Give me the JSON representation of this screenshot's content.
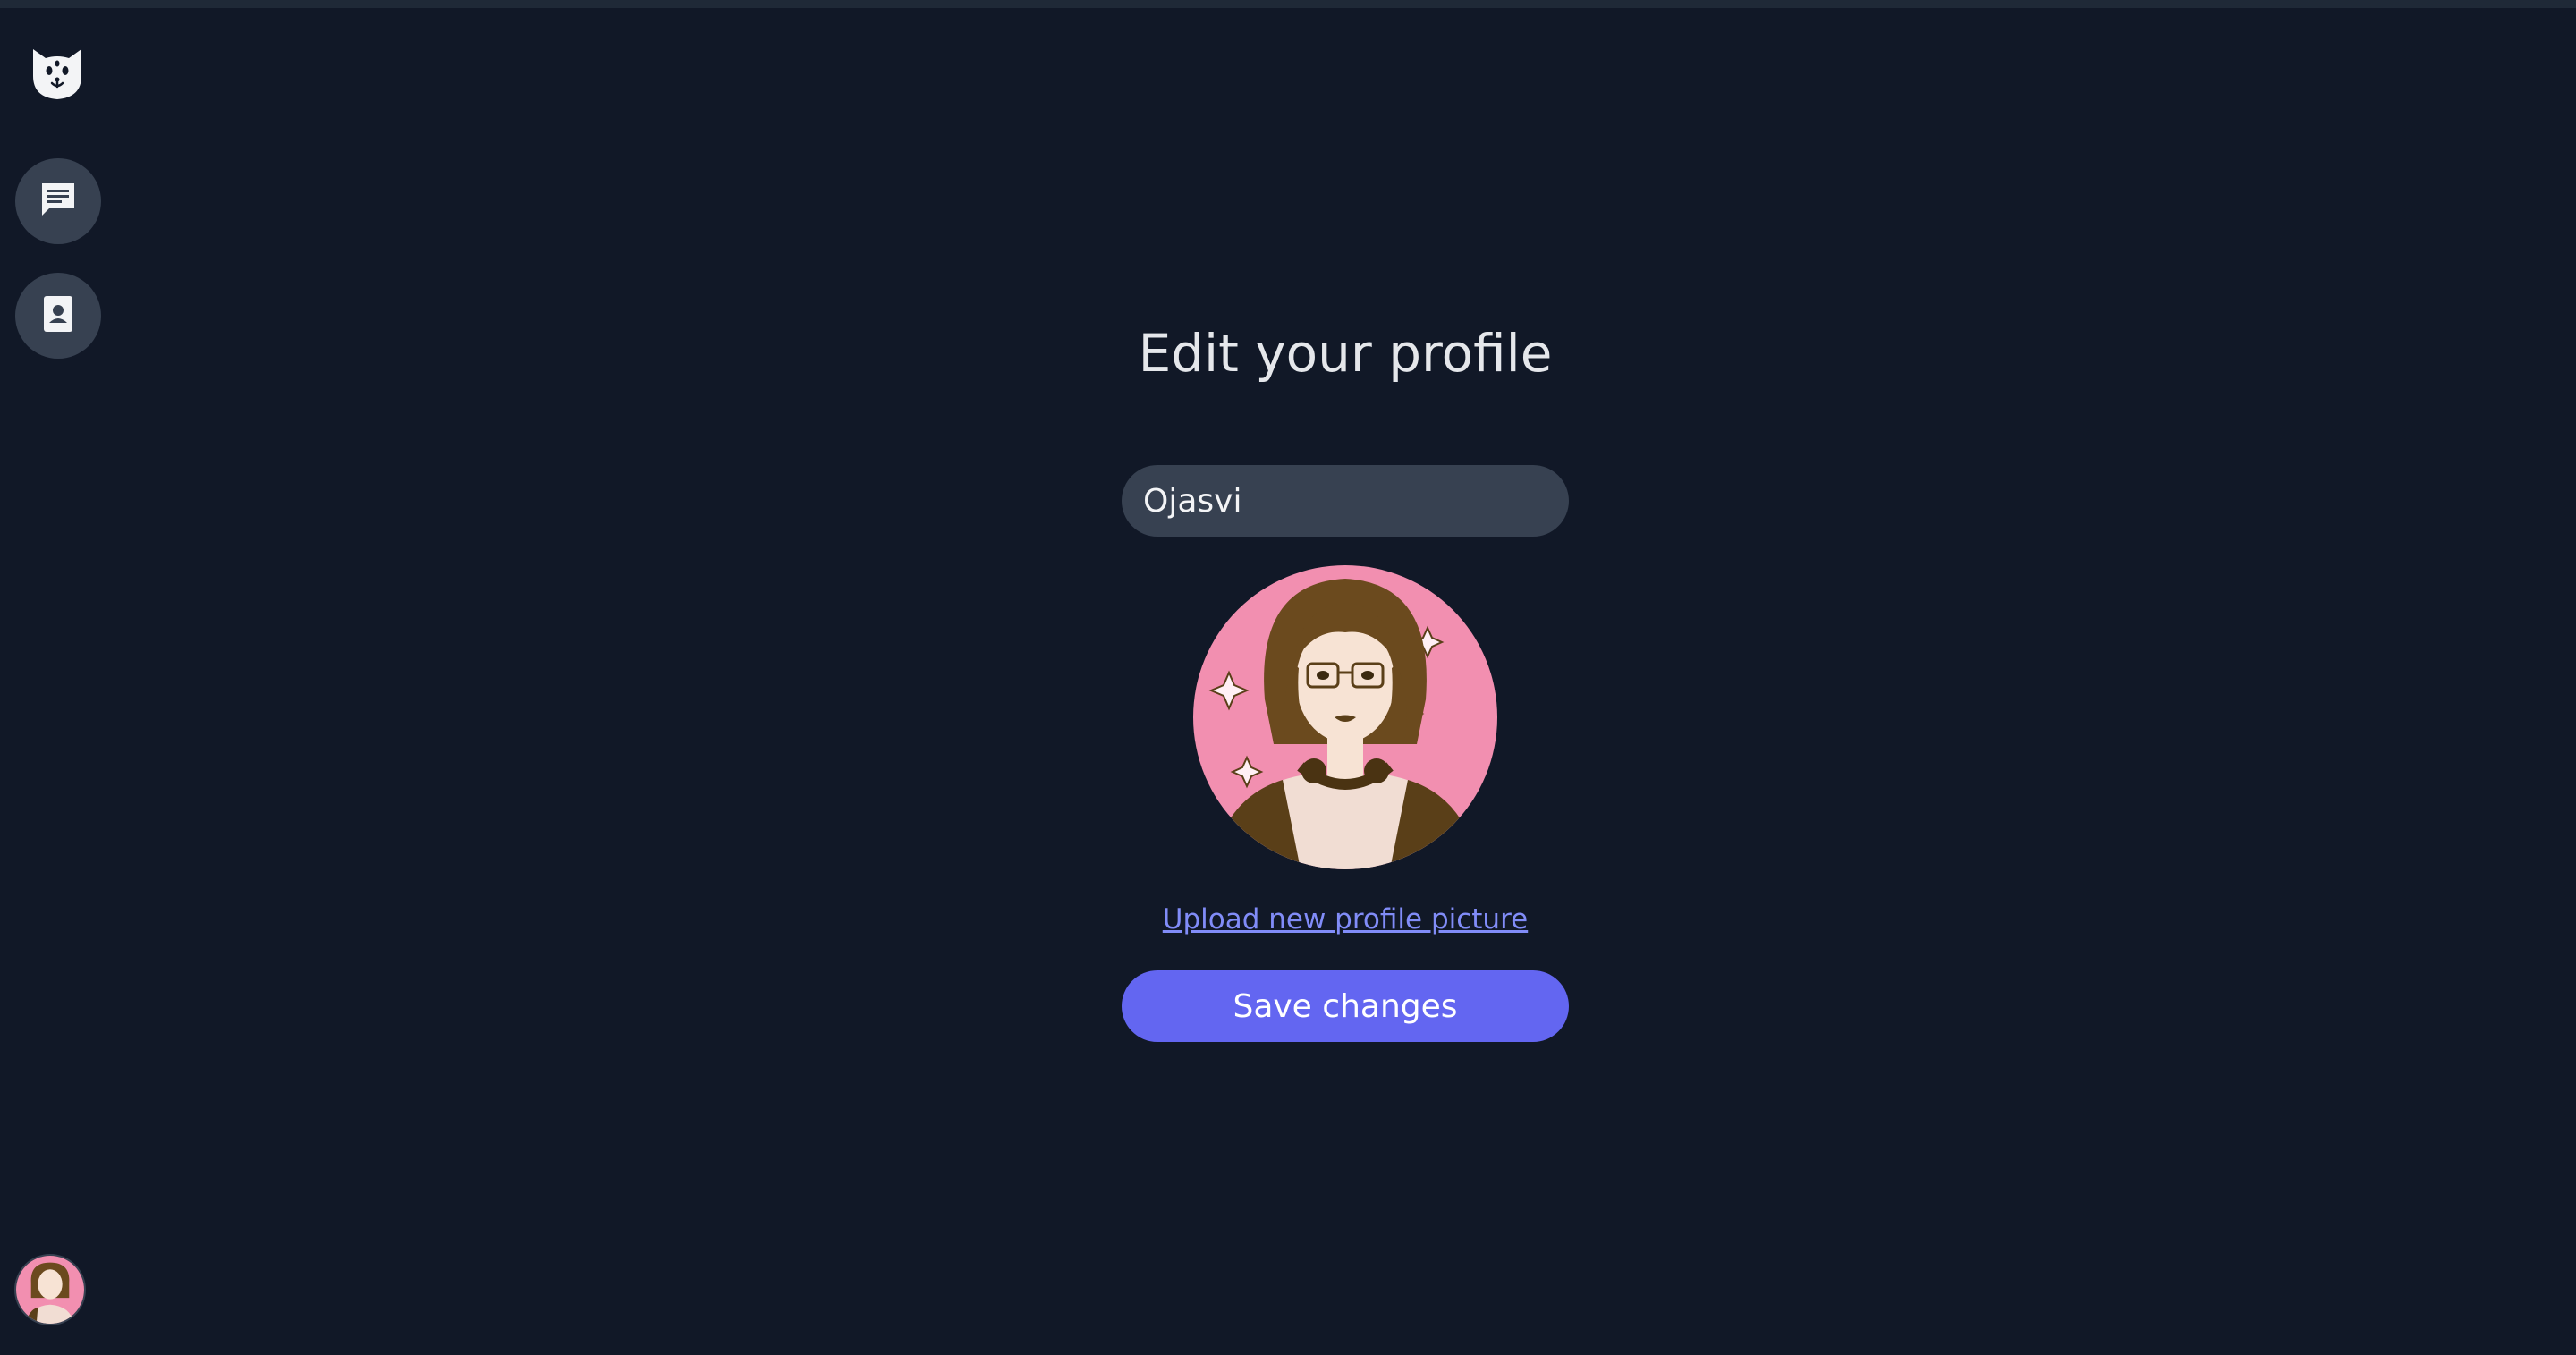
{
  "page": {
    "title": "Edit your profile"
  },
  "profile": {
    "name_value": "Ojasvi",
    "upload_link_label": "Upload new profile picture",
    "save_label": "Save changes"
  },
  "sidebar": {
    "logo_icon": "cat-face-icon",
    "items": [
      {
        "icon": "chat-icon"
      },
      {
        "icon": "contacts-icon"
      }
    ],
    "user_avatar": "avatar"
  },
  "colors": {
    "background": "#111827",
    "surface": "#374151",
    "accent": "#6366f1",
    "link": "#818cf8",
    "text": "#e5e7eb"
  }
}
